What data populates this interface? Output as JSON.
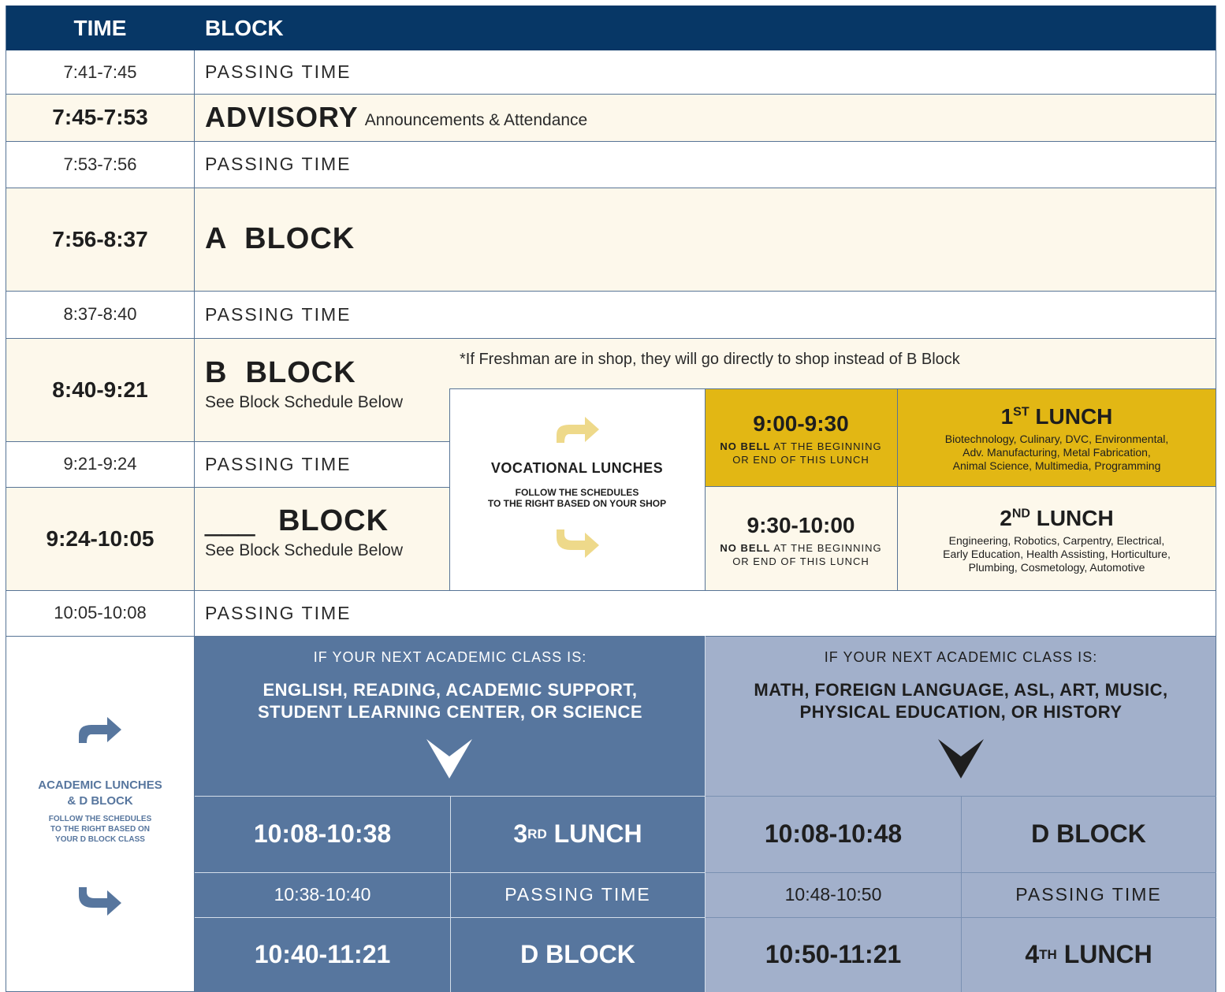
{
  "header": {
    "time_label": "TIME",
    "block_label": "BLOCK"
  },
  "rows": {
    "r1": {
      "time": "7:41-7:45",
      "label": "PASSING TIME"
    },
    "r2": {
      "time": "7:45-7:53",
      "title": "ADVISORY",
      "detail": "Announcements & Attendance"
    },
    "r3": {
      "time": "7:53-7:56",
      "label": "PASSING TIME"
    },
    "r4": {
      "time": "7:56-8:37",
      "title": "A  BLOCK"
    },
    "r5": {
      "time": "8:37-8:40",
      "label": "PASSING TIME"
    },
    "r6": {
      "time": "8:40-9:21",
      "title": "B  BLOCK",
      "sub": "See Block Schedule Below",
      "note": "*If Freshman are in shop, they will go directly to shop instead of B Block"
    },
    "r7": {
      "time": "9:21-9:24",
      "label": "PASSING TIME"
    },
    "r8": {
      "time": "9:24-10:05",
      "blank": "___",
      "title": "BLOCK",
      "sub": "See Block Schedule Below"
    },
    "r9": {
      "time": "10:05-10:08",
      "label": "PASSING TIME"
    }
  },
  "vocational": {
    "title": "VOCATIONAL LUNCHES",
    "subtitle_1": "FOLLOW THE SCHEDULES",
    "subtitle_2": "TO THE RIGHT BASED ON YOUR SHOP",
    "lunch1": {
      "time": "9:00-9:30",
      "bell_bold": "NO BELL",
      "bell_rest": " AT THE BEGINNING",
      "bell_line2": "OR END OF THIS LUNCH",
      "name_num": "1",
      "name_sup": "ST",
      "name_rest": " LUNCH",
      "shops_1": "Biotechnology, Culinary, DVC, Environmental,",
      "shops_2": "Adv. Manufacturing, Metal Fabrication,",
      "shops_3": "Animal Science, Multimedia, Programming"
    },
    "lunch2": {
      "time": "9:30-10:00",
      "bell_bold": "NO BELL",
      "bell_rest": " AT THE BEGINNING",
      "bell_line2": "OR END OF THIS LUNCH",
      "name_num": "2",
      "name_sup": "ND",
      "name_rest": " LUNCH",
      "shops_1": "Engineering, Robotics, Carpentry, Electrical,",
      "shops_2": "Early Education, Health Assisting, Horticulture,",
      "shops_3": "Plumbing, Cosmetology, Automotive"
    }
  },
  "academic": {
    "title_1": "ACADEMIC LUNCHES",
    "title_2": "& D BLOCK",
    "sub_1": "FOLLOW THE SCHEDULES",
    "sub_2": "TO THE RIGHT BASED ON",
    "sub_3": "YOUR D BLOCK CLASS",
    "left": {
      "intro": "IF YOUR NEXT ACADEMIC CLASS IS:",
      "subjects_1": "ENGLISH, READING, ACADEMIC SUPPORT,",
      "subjects_2": "STUDENT LEARNING CENTER, OR SCIENCE",
      "row1_time": "10:08-10:38",
      "row1_num": "3",
      "row1_sup": "RD",
      "row1_rest": " LUNCH",
      "row2_time": "10:38-10:40",
      "row2_label": "PASSING TIME",
      "row3_time": "10:40-11:21",
      "row3_label": "D BLOCK"
    },
    "right": {
      "intro": "IF YOUR NEXT ACADEMIC CLASS IS:",
      "subjects_1": "MATH, FOREIGN LANGUAGE, ASL, ART, MUSIC,",
      "subjects_2": "PHYSICAL EDUCATION, OR HISTORY",
      "row1_time": "10:08-10:48",
      "row1_label": "D BLOCK",
      "row2_time": "10:48-10:50",
      "row2_label": "PASSING TIME",
      "row3_time": "10:50-11:21",
      "row3_num": "4",
      "row3_sup": "TH",
      "row3_rest": " LUNCH"
    }
  },
  "colors": {
    "header": "#073766",
    "cream": "#fdf8eb",
    "gold": "#e2b714",
    "steel_blue": "#57769e",
    "light_blue": "#a2b0cb",
    "arrow_gold": "#eed98a",
    "arrow_blue": "#57769e"
  }
}
